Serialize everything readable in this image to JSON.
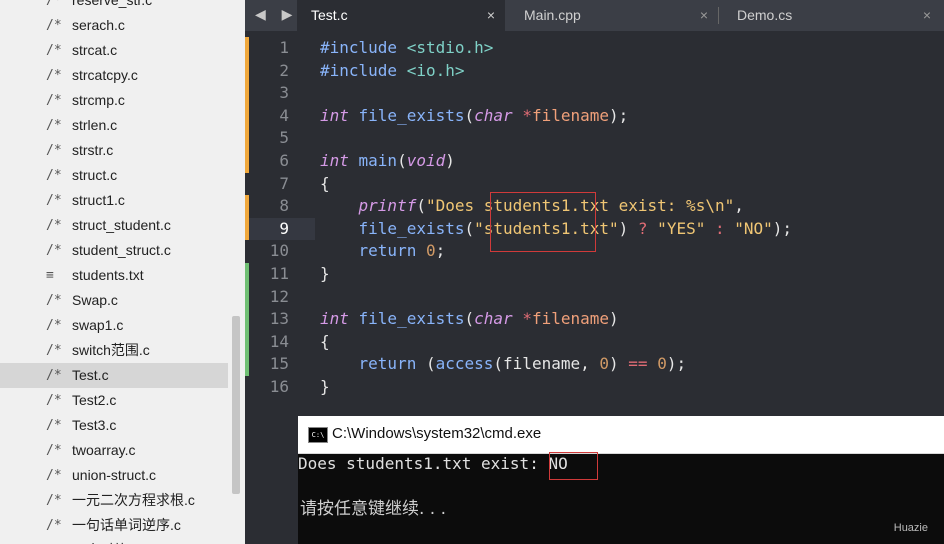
{
  "sidebar": {
    "files": [
      {
        "icon": "/*",
        "name": "reserve_str.c"
      },
      {
        "icon": "/*",
        "name": "serach.c"
      },
      {
        "icon": "/*",
        "name": "strcat.c"
      },
      {
        "icon": "/*",
        "name": "strcatcpy.c"
      },
      {
        "icon": "/*",
        "name": "strcmp.c"
      },
      {
        "icon": "/*",
        "name": "strlen.c"
      },
      {
        "icon": "/*",
        "name": "strstr.c"
      },
      {
        "icon": "/*",
        "name": "struct.c"
      },
      {
        "icon": "/*",
        "name": "struct1.c"
      },
      {
        "icon": "/*",
        "name": "struct_student.c"
      },
      {
        "icon": "/*",
        "name": "student_struct.c"
      },
      {
        "icon": "≡",
        "name": "students.txt"
      },
      {
        "icon": "/*",
        "name": "Swap.c"
      },
      {
        "icon": "/*",
        "name": "swap1.c"
      },
      {
        "icon": "/*",
        "name": "switch范围.c"
      },
      {
        "icon": "/*",
        "name": "Test.c",
        "selected": true
      },
      {
        "icon": "/*",
        "name": "Test2.c"
      },
      {
        "icon": "/*",
        "name": "Test3.c"
      },
      {
        "icon": "/*",
        "name": "twoarray.c"
      },
      {
        "icon": "/*",
        "name": "union-struct.c"
      },
      {
        "icon": "/*",
        "name": "一元二次方程求根.c"
      },
      {
        "icon": "/*",
        "name": "一句话单词逆序.c"
      },
      {
        "icon": "/*",
        "name": "一小时练习.c"
      }
    ]
  },
  "editor": {
    "nav_arrows": "◀ ▶",
    "tabs": [
      {
        "label": "Test.c",
        "close": "×"
      },
      {
        "label": "Main.cpp",
        "close": "×"
      },
      {
        "label": "Demo.cs",
        "close": "×"
      }
    ],
    "lines": [
      {
        "n": "1",
        "gutter": "#f0a83c",
        "tokens": [
          [
            "#include ",
            "t-dir"
          ],
          [
            "<stdio.h>",
            "t-incl"
          ]
        ]
      },
      {
        "n": "2",
        "gutter": "#f0a83c",
        "tokens": [
          [
            "#include ",
            "t-dir"
          ],
          [
            "<io.h>",
            "t-incl"
          ]
        ]
      },
      {
        "n": "3",
        "gutter": "#f0a83c",
        "tokens": []
      },
      {
        "n": "4",
        "gutter": "#f0a83c",
        "tokens": [
          [
            "int ",
            "t-it"
          ],
          [
            "file_exists",
            "t-fn"
          ],
          [
            "(",
            "t-id"
          ],
          [
            "char ",
            "t-it"
          ],
          [
            "*",
            "t-op"
          ],
          [
            "filename",
            "t-param"
          ],
          [
            ");",
            "t-id"
          ]
        ]
      },
      {
        "n": "5",
        "gutter": "#f0a83c",
        "tokens": []
      },
      {
        "n": "6",
        "gutter": "#f0a83c",
        "tokens": [
          [
            "int ",
            "t-it"
          ],
          [
            "main",
            "t-fn"
          ],
          [
            "(",
            "t-id"
          ],
          [
            "void",
            "t-it"
          ],
          [
            ")",
            "t-id"
          ]
        ]
      },
      {
        "n": "7",
        "gutter": "",
        "tokens": [
          [
            "{",
            "t-id"
          ]
        ]
      },
      {
        "n": "8",
        "gutter": "#f0a83c",
        "tokens": [
          [
            "    ",
            "t-id"
          ],
          [
            "printf",
            "t-it"
          ],
          [
            "(",
            "t-id"
          ],
          [
            "\"Does students1.txt exist: %s\\n\"",
            "t-str"
          ],
          [
            ",",
            "t-id"
          ]
        ]
      },
      {
        "n": "9",
        "gutter": "#f0a83c",
        "current": true,
        "tokens": [
          [
            "    ",
            "t-id"
          ],
          [
            "file_exists",
            "t-fn"
          ],
          [
            "(",
            "t-id"
          ],
          [
            "\"students1.txt\"",
            "t-str"
          ],
          [
            ") ",
            "t-id"
          ],
          [
            "?",
            "t-op"
          ],
          [
            " \"YES\" ",
            "t-str"
          ],
          [
            ":",
            "t-op"
          ],
          [
            " \"NO\"",
            "t-str"
          ],
          [
            ");",
            "t-id"
          ]
        ]
      },
      {
        "n": "10",
        "gutter": "",
        "tokens": [
          [
            "    ",
            "t-id"
          ],
          [
            "return ",
            "t-kw"
          ],
          [
            "0",
            "t-num"
          ],
          [
            ";",
            "t-id"
          ]
        ]
      },
      {
        "n": "11",
        "gutter": "#6fbf73",
        "tokens": [
          [
            "}",
            "t-id"
          ]
        ]
      },
      {
        "n": "12",
        "gutter": "#6fbf73",
        "tokens": []
      },
      {
        "n": "13",
        "gutter": "#6fbf73",
        "tokens": [
          [
            "int ",
            "t-it"
          ],
          [
            "file_exists",
            "t-fn"
          ],
          [
            "(",
            "t-id"
          ],
          [
            "char ",
            "t-it"
          ],
          [
            "*",
            "t-op"
          ],
          [
            "filename",
            "t-param"
          ],
          [
            ")",
            "t-id"
          ]
        ]
      },
      {
        "n": "14",
        "gutter": "#6fbf73",
        "tokens": [
          [
            "{",
            "t-id"
          ]
        ]
      },
      {
        "n": "15",
        "gutter": "#6fbf73",
        "tokens": [
          [
            "    ",
            "t-id"
          ],
          [
            "return ",
            "t-kw"
          ],
          [
            "(",
            "t-id"
          ],
          [
            "access",
            "t-fn"
          ],
          [
            "(filename, ",
            "t-id"
          ],
          [
            "0",
            "t-num"
          ],
          [
            ") ",
            "t-id"
          ],
          [
            "==",
            "t-op"
          ],
          [
            " ",
            "t-id"
          ],
          [
            "0",
            "t-num"
          ],
          [
            ");",
            "t-id"
          ]
        ]
      },
      {
        "n": "16",
        "gutter": "",
        "tokens": [
          [
            "}",
            "t-id"
          ]
        ]
      }
    ]
  },
  "console": {
    "icon": "C:\\",
    "title": "C:\\Windows\\system32\\cmd.exe",
    "output_line1": "Does students1.txt exist: NO",
    "output_line2": "请按任意键继续. . ."
  },
  "watermark": "Huazie",
  "colors": {
    "editor_bg": "#2b2d33",
    "tab_bar": "#3b3e46",
    "modified_gutter": "#f0a83c",
    "added_gutter": "#6fbf73",
    "highlight_box": "#d03a3a"
  }
}
